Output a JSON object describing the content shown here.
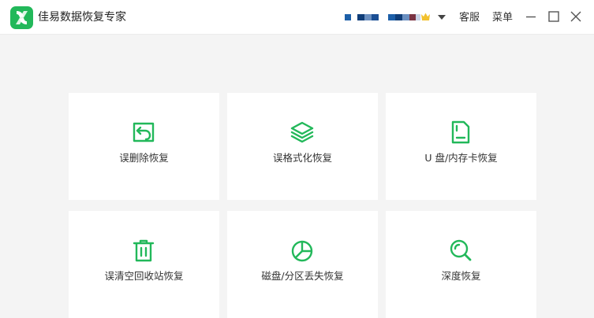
{
  "app": {
    "title": "佳易数据恢复专家"
  },
  "header": {
    "service_label": "客服",
    "menu_label": "菜单"
  },
  "colors": {
    "accent": "#22b85a",
    "account_blocks": [
      "#1d5fa8",
      "#0f3d78",
      "#6a8fc0",
      "#1b4f94",
      "#7a3342",
      "#c7d3e6"
    ]
  },
  "options": [
    {
      "label": "误删除恢复",
      "icon": "deleted-file-restore-icon"
    },
    {
      "label": "误格式化恢复",
      "icon": "layers-icon"
    },
    {
      "label": "U 盘/内存卡恢复",
      "icon": "memory-card-icon"
    },
    {
      "label": "误清空回收站恢复",
      "icon": "trash-bin-icon"
    },
    {
      "label": "磁盘/分区丢失恢复",
      "icon": "pie-chart-icon"
    },
    {
      "label": "深度恢复",
      "icon": "deep-search-icon"
    }
  ]
}
